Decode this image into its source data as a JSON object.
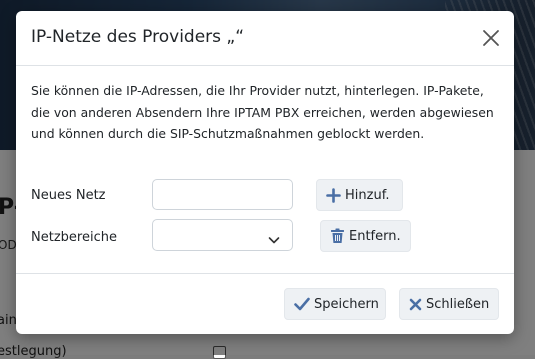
{
  "background": {
    "heading_fragment": "P-",
    "sub_fragment": "ODI",
    "line1_fragment": "ain",
    "line2_fragment": "estlegung)"
  },
  "modal": {
    "title": "IP-Netze des Providers „“",
    "description": "Sie können die IP-Adressen, die Ihr Provider nutzt, hinterlegen. IP-Pakete, die von anderen Absendern Ihre IPTAM PBX erreichen, werden abgewiesen und können durch die SIP-Schutzmaßnahmen geblockt werden.",
    "new_net": {
      "label": "Neues Netz",
      "value": "",
      "placeholder": ""
    },
    "add_button": "Hinzuf.",
    "ranges": {
      "label": "Netzbereiche",
      "selected": ""
    },
    "remove_button": "Entfern.",
    "save_button": "Speichern",
    "close_button": "Schließen"
  },
  "colors": {
    "icon_blue": "#4a6fa5",
    "overlay": "#000000"
  },
  "icons": {
    "close": "close-x-icon",
    "add": "plus-icon",
    "remove": "trash-icon",
    "save": "check-icon",
    "cancel": "x-icon",
    "dropdown": "chevron-down-icon"
  }
}
